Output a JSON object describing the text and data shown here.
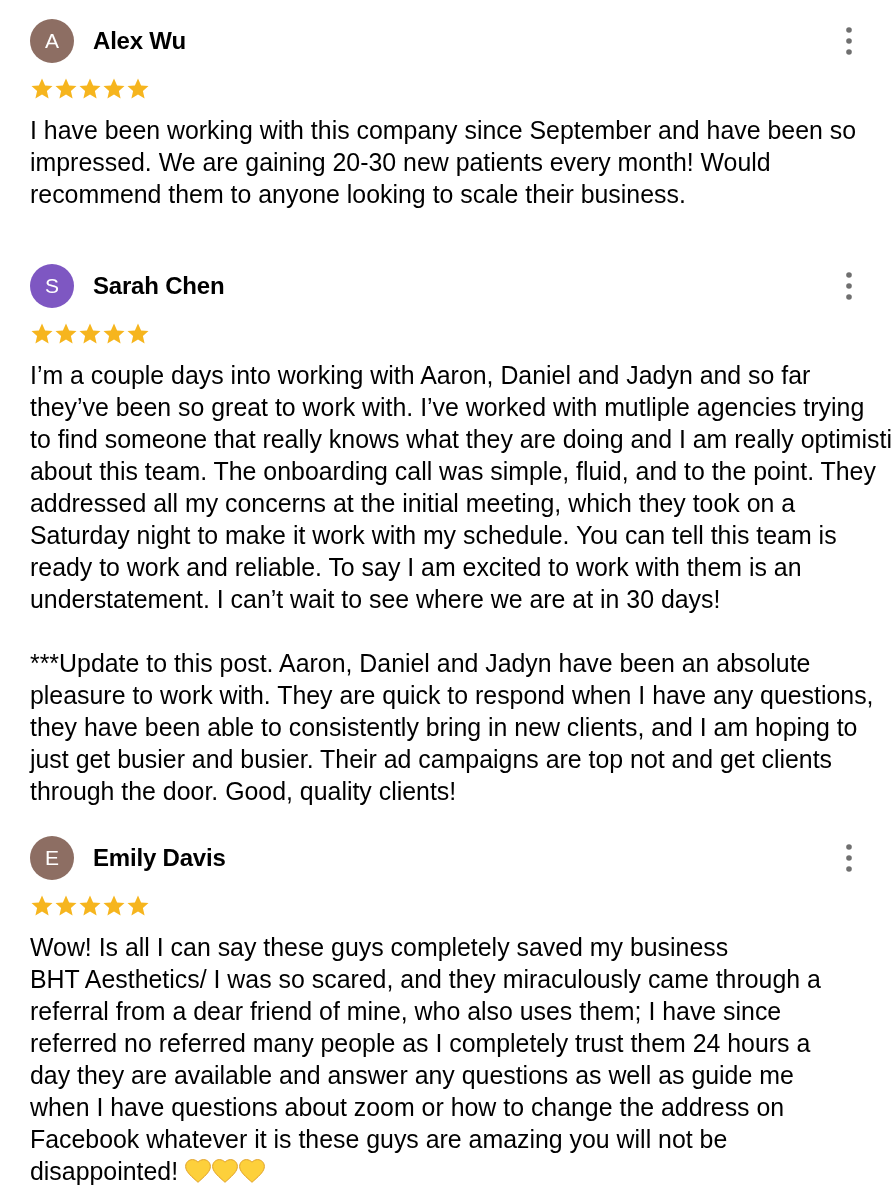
{
  "reviews": [
    {
      "initial": "A",
      "color": "#8d6e63",
      "name": "Alex Wu",
      "stars": 5,
      "paragraphs": [
        {
          "lines": [
            "I have been working with this company since September and have been so",
            "impressed. We are gaining 20-30 new patients every month! Would",
            "recommend them to anyone looking to scale their business."
          ]
        }
      ]
    },
    {
      "initial": "S",
      "color": "#7e57c2",
      "name": "Sarah Chen",
      "stars": 5,
      "paragraphs": [
        {
          "lines": [
            "I’m a couple days into working with Aaron, Daniel and Jadyn and so far",
            "they’ve been so great to work with. I’ve worked with mutliple agencies trying",
            "to find someone that really knows what they are doing and I am really optimisti",
            "about this team. The onboarding call was simple, fluid, and to the point. They",
            "addressed all my concerns at the initial meeting, which they took on a",
            "Saturday night to make it work with my schedule. You can tell this team is",
            "ready to work and reliable. To say I am excited to work with them is an",
            "understatement. I can’t wait to see where we are at in 30 days!"
          ]
        },
        {
          "lines": [
            "***Update to this post. Aaron, Daniel and Jadyn have been an absolute",
            "pleasure to work with. They are quick to respond when I have any questions,",
            "they have been able to consistently bring in new clients, and I am hoping to",
            "just get busier and busier. Their ad campaigns are top not and get clients",
            "through the door. Good, quality clients!"
          ]
        }
      ]
    },
    {
      "initial": "E",
      "color": "#8d6e63",
      "name": "Emily Davis",
      "stars": 5,
      "paragraphs": [
        {
          "lines": [
            "Wow! Is all I can say these guys completely saved my business",
            "BHT Aesthetics/ I was so scared, and they miraculously came through a",
            "referral from a dear friend of mine, who also uses them; I have since",
            "referred no referred many people as I completely trust them 24 hours a",
            "day they are available and answer any questions as well as guide me",
            "when I have questions about zoom or how to change the address on",
            "Facebook whatever it is these guys are amazing you will not be",
            "disappointed!"
          ],
          "emoji": [
            {
              "kind": "heart"
            },
            {
              "kind": "heart"
            },
            {
              "kind": "heart"
            }
          ]
        }
      ]
    }
  ]
}
